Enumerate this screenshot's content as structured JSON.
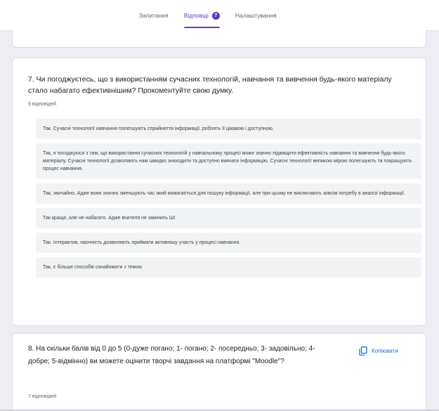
{
  "tabs": [
    {
      "label": "Запитання"
    },
    {
      "label": "Відповіді",
      "badge": "7"
    },
    {
      "label": "Налаштування"
    }
  ],
  "colors": {
    "accent": "#673ab7",
    "link": "#1a73e8"
  },
  "question7": {
    "title": "7. Чи погоджуєтесь, що з використанням сучасних технологій, навчання та вивчення будь-якого матеріалу стало набагато ефективнішим? Прокоментуйте свою думку.",
    "count": "5 відповідей",
    "answers": [
      "Так. Сучасні технології навчання полегшують сприйняття інформації, роблять її цікавою і доступною.",
      "Так, я погоджуюся з тим, що використання сучасних технологій у навчальному процесі може значно підвищити ефективність навчання та вивчення будь-якого матеріалу. Сучасні технології дозволяють нам швидко знаходити та доступно вивчати інформацію. Сучасні технології великою мірою полегшують та покращують процес навчання.",
      "Так, звичайно. Адже вони значно зменшують час який вимагається для пошуку інформації, але при цьому не виключають зовсім потребу в аналізі інформації.",
      "Так краще, але не набагато. Адже вчителя не замінить ШІ",
      "Так. Інтерактив, наочність дозволяють приймати активнішу участь у процесі навчання.",
      "Так, є більше способів ознайомити з темою"
    ]
  },
  "question8": {
    "title": "8. На скільки балів від 0 до 5 (0-дуже погано; 1- погано; 2- посередньо; 3- задовільно; 4-добре; 5-відмінно) ви можете оцінити творчі завдання на платформі \"Moodle\"?",
    "count": "7 відповідей",
    "copy_label": "Копіювати",
    "copy_icon": "copy-icon"
  }
}
